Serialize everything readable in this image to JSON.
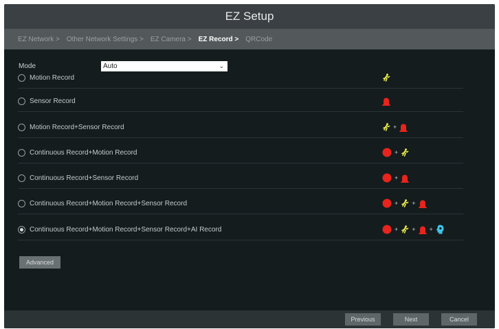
{
  "window": {
    "title": "EZ Setup"
  },
  "breadcrumb": [
    {
      "label": "EZ Network >",
      "active": false
    },
    {
      "label": "Other Network Settings >",
      "active": false
    },
    {
      "label": "EZ Camera >",
      "active": false
    },
    {
      "label": "EZ Record >",
      "active": true
    },
    {
      "label": "QRCode",
      "active": false
    }
  ],
  "mode": {
    "label": "Mode",
    "value": "Auto"
  },
  "options": [
    {
      "label": "Motion Record",
      "checked": false,
      "icons": [
        "motion-icon"
      ]
    },
    {
      "label": "Sensor Record",
      "checked": false,
      "icons": [
        "alarm-icon"
      ]
    },
    {
      "label": "Motion Record+Sensor Record",
      "checked": false,
      "icons": [
        "motion-icon",
        "alarm-icon"
      ]
    },
    {
      "label": "Continuous Record+Motion Record",
      "checked": false,
      "icons": [
        "record-dot-icon",
        "motion-icon"
      ]
    },
    {
      "label": "Continuous Record+Sensor Record",
      "checked": false,
      "icons": [
        "record-dot-icon",
        "alarm-icon"
      ]
    },
    {
      "label": "Continuous Record+Motion Record+Sensor Record",
      "checked": false,
      "icons": [
        "record-dot-icon",
        "motion-icon",
        "alarm-icon"
      ]
    },
    {
      "label": "Continuous Record+Motion Record+Sensor Record+AI Record",
      "checked": true,
      "icons": [
        "record-dot-icon",
        "motion-icon",
        "alarm-icon",
        "ai-head-icon"
      ]
    }
  ],
  "plus_sign": "+",
  "buttons": {
    "advanced": "Advanced",
    "previous": "Previous",
    "next": "Next",
    "cancel": "Cancel"
  },
  "colors": {
    "motion": "#e9e84a",
    "alarm": "#e8241c",
    "record": "#e8241c",
    "ai": "#3fc3e8"
  }
}
